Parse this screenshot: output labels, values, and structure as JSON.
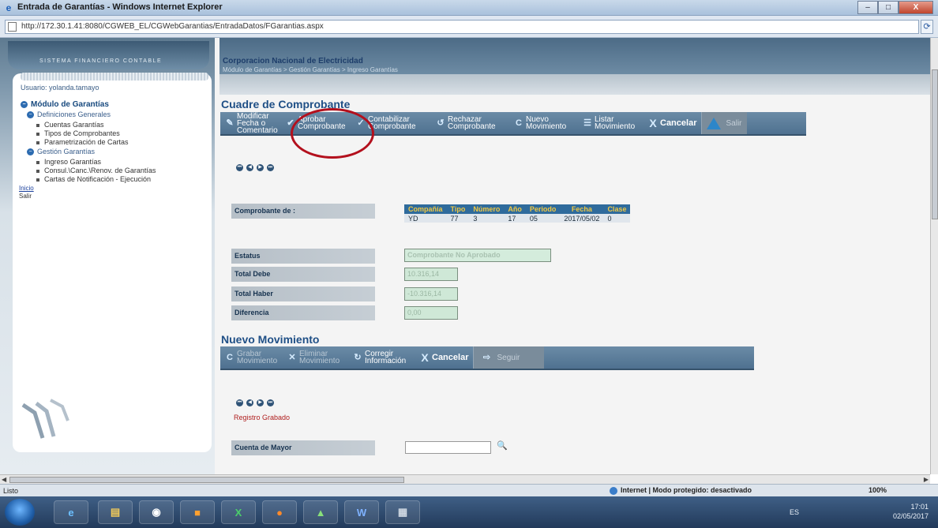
{
  "window": {
    "title": "Entrada de Garantías - Windows Internet Explorer",
    "minimize": "–",
    "maximize": "□",
    "close": "X"
  },
  "address": {
    "url": "http://172.30.1.41:8080/CGWEB_EL/CGWebGarantias/EntradaDatos/FGarantias.aspx"
  },
  "sidebar": {
    "subtitle": "SISTEMA FINANCIERO CONTABLE",
    "user": "Usuario: yolanda.tamayo",
    "module": "Módulo de Garantías",
    "groups": [
      {
        "label": "Definiciones Generales",
        "items": [
          "Cuentas Garantías",
          "Tipos de Comprobantes",
          "Parametrización de Cartas"
        ]
      },
      {
        "label": "Gestión Garantías",
        "items": [
          "Ingreso Garantías",
          "Consul.\\Canc.\\Renov. de Garantías",
          "Cartas de Notificación - Ejecución"
        ]
      }
    ],
    "links": [
      "Inicio",
      "Salir"
    ]
  },
  "header": {
    "company": "Corporacion Nacional de Electricidad",
    "breadcrumb": "Módulo de Garantías > Gestión Garantías > Ingreso Garantías"
  },
  "cuadre": {
    "title": "Cuadre de Comprobante",
    "toolbar": {
      "modificar": "Modificar Fecha o Comentario",
      "aprobar": "Aprobar Comprobante",
      "contabilizar": "Contabilizar Comprobante",
      "rechazar": "Rechazar Comprobante",
      "nuevo": "Nuevo Movimiento",
      "listar": "Listar Movimiento",
      "cancelar": "Cancelar",
      "salir": "Salir"
    },
    "comprobante_label": "Comprobante de :",
    "table": {
      "headers": [
        "Compañía",
        "Tipo",
        "Número",
        "Año",
        "Periodo",
        "Fecha",
        "Clase"
      ],
      "row": [
        "YD",
        "77",
        "3",
        "17",
        "05",
        "2017/05/02",
        "0"
      ]
    },
    "estatus_label": "Estatus",
    "estatus_value": "Comprobante No Aprobado",
    "total_debe_label": "Total Debe",
    "total_debe_value": "10.316,14",
    "total_haber_label": "Total Haber",
    "total_haber_value": "-10.316,14",
    "diferencia_label": "Diferencia",
    "diferencia_value": "0,00"
  },
  "movimiento": {
    "title": "Nuevo Movimiento",
    "toolbar": {
      "grabar": "Grabar Movimiento",
      "eliminar": "Eliminar Movimiento",
      "corregir": "Corregir Información",
      "cancelar": "Cancelar",
      "seguir": "Seguir"
    },
    "registro": "Registro Grabado",
    "cuenta_label": "Cuenta de Mayor",
    "cuenta_value": ""
  },
  "statusbar": {
    "left": "Listo",
    "zone": "Internet | Modo protegido: desactivado",
    "zoom": "100%"
  },
  "taskbar": {
    "lang": "ES",
    "time": "17:01",
    "date": "02/05/2017"
  }
}
